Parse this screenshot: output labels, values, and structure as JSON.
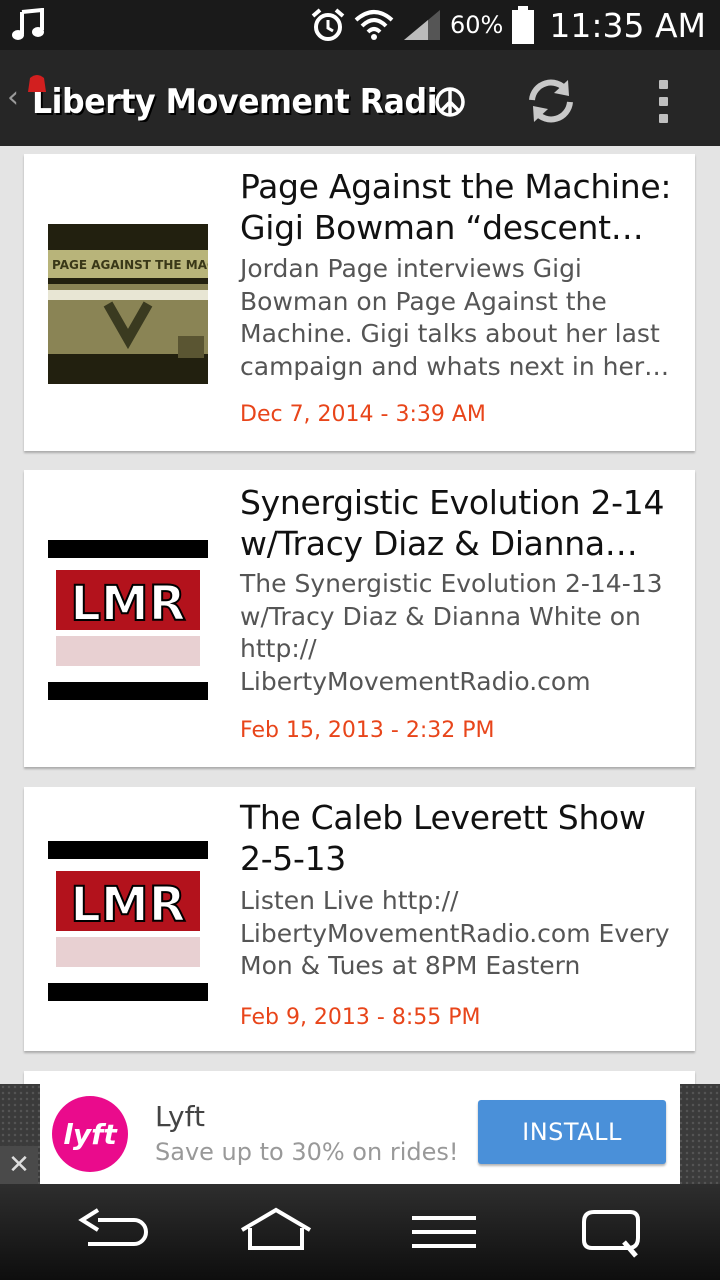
{
  "status_bar": {
    "battery_percent": "60%",
    "time": "11:35 AM",
    "icons": [
      "music-icon",
      "alarm-icon",
      "wifi-icon",
      "signal-icon",
      "battery-icon"
    ]
  },
  "app_bar": {
    "title": "Liberty Movement Radio",
    "back_icon": "chevron-left-icon",
    "actions": [
      "refresh-icon",
      "overflow-menu-icon"
    ]
  },
  "feed": {
    "items": [
      {
        "title": "Page Against the Machine: Gigi Bowman “descent…",
        "description": "Jordan Page interviews Gigi Bowman on Page Against the Machine. Gigi talks about her last campaign and whats next in her…",
        "date": "Dec 7, 2014 - 3:39 AM",
        "thumb_text": "PAGE AGAINST THE MACHINE"
      },
      {
        "title": "Synergistic Evolution 2-14 w/Tracy Diaz & Dianna…",
        "description": "The Synergistic Evolution 2-14-13 w/Tracy Diaz & Dianna White on http:// LibertyMovementRadio.com",
        "date": "Feb 15, 2013 - 2:32 PM",
        "thumb_text": "LMR"
      },
      {
        "title": "The Caleb Leverett Show 2-5-13",
        "description": "Listen Live http:// LibertyMovementRadio.com Every Mon & Tues at 8PM Eastern",
        "date": "Feb 9, 2013 - 8:55 PM",
        "thumb_text": "LMR"
      }
    ]
  },
  "ad": {
    "brand": "Lyft",
    "logo_text": "lyft",
    "tagline": "Save up to 30% on rides!",
    "cta": "INSTALL",
    "close": "✕",
    "brand_color": "#ea0b8c",
    "cta_color": "#4a90d9"
  },
  "nav_bar": {
    "buttons": [
      "back-icon",
      "home-icon",
      "menu-icon",
      "recent-apps-icon"
    ]
  },
  "colors": {
    "date_accent": "#e8451a",
    "app_bar": "#262626",
    "status_bar": "#1a1a1a"
  }
}
